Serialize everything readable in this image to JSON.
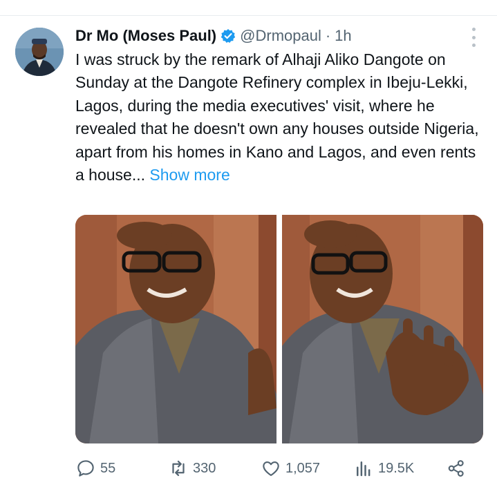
{
  "tweet": {
    "author_name": "Dr Mo (Moses Paul)",
    "handle": "@Drmopaul",
    "separator": "·",
    "time": "1h",
    "text": "I was struck by the remark of Alhaji Aliko Dangote on Sunday at the Dangote Refinery complex in Ibeju-Lekki, Lagos, during the media executives' visit, where he revealed that he doesn't own any houses outside Nigeria, apart from his homes in Kano and Lagos, and even rents a house...",
    "show_more": "Show more"
  },
  "actions": {
    "replies": "55",
    "reposts": "330",
    "likes": "1,057",
    "views": "19.5K"
  },
  "colors": {
    "accent": "#1d9bf0",
    "secondary_text": "#536471",
    "primary_text": "#0f1419"
  },
  "icons": [
    "verified-badge-icon",
    "more-options-icon",
    "reply-icon",
    "repost-icon",
    "like-icon",
    "views-icon",
    "share-icon"
  ]
}
